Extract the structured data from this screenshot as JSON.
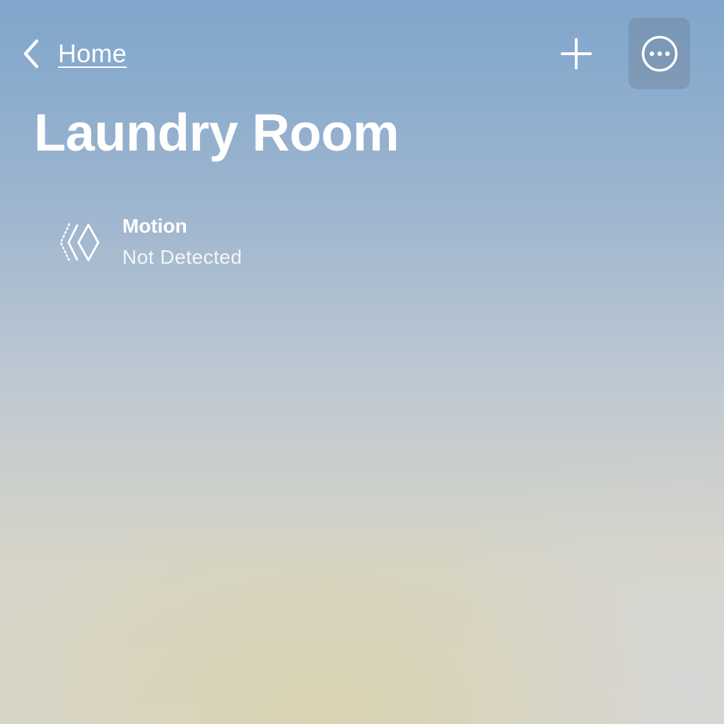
{
  "nav": {
    "back_label": "Home",
    "back_icon": "chevron-left-icon",
    "add_icon": "plus-icon",
    "more_icon": "ellipsis-circle-icon"
  },
  "room": {
    "title": "Laundry Room"
  },
  "accessories": [
    {
      "name": "Motion",
      "status": "Not Detected",
      "icon": "motion-sensor-icon"
    }
  ],
  "colors": {
    "text": "#ffffff",
    "background_top": "#7fa6cc",
    "background_bottom": "#d8d5c8",
    "more_button_bg": "#6e8096"
  }
}
